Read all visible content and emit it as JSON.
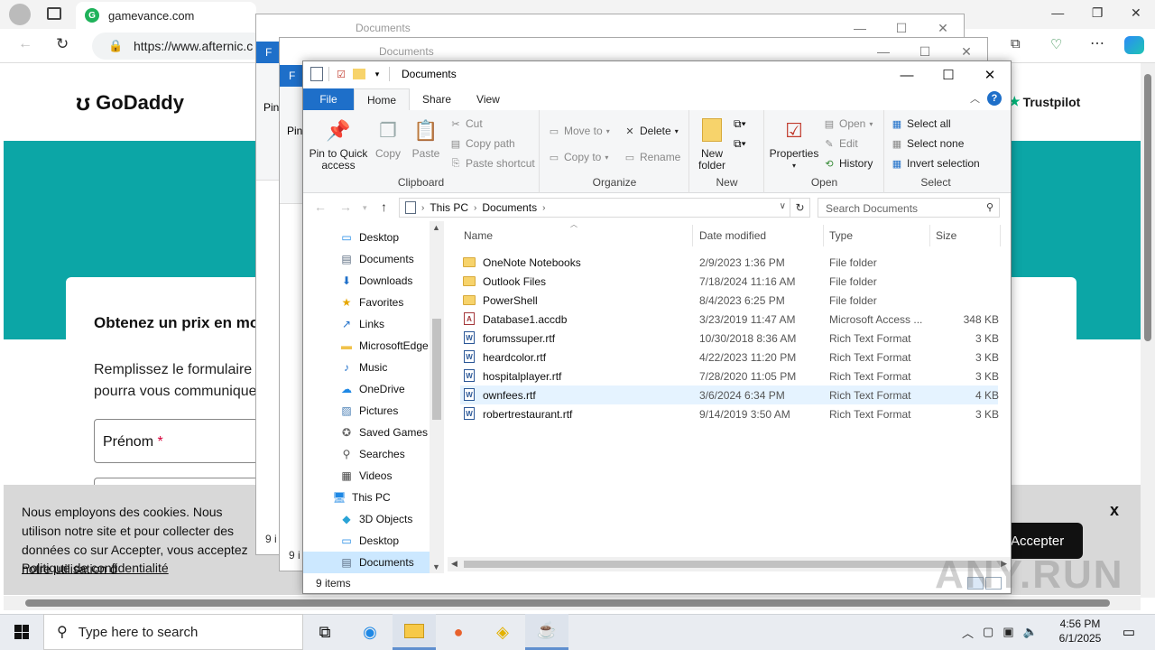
{
  "browser": {
    "tab_title": "gamevance.com",
    "url": "https://www.afternic.c",
    "window_controls": [
      "—",
      "❐",
      "✕"
    ]
  },
  "website": {
    "logo_text": "GoDaddy",
    "trustpilot": "Trustpilot",
    "form_title": "Obtenez un prix en mo",
    "form_desc": "Remplissez le formulaire c pourra vous communique",
    "field_firstname": "Prénom",
    "required_mark": "*",
    "cookie_text": "Nous employons des cookies. Nous utilison notre site et pour collecter des données co sur Accepter, vous acceptez notre utilisation d",
    "cookie_link": "Politique de confidentialité",
    "accept_button": "Accepter",
    "cookie_close": "x"
  },
  "bg_windows": [
    {
      "title": "Documents",
      "file_tab": "F",
      "pin": "Pin",
      "status": "9 i"
    },
    {
      "title": "Documents",
      "file_tab": "F",
      "pin": "Pin",
      "status": "9 i"
    }
  ],
  "explorer": {
    "title": "Documents",
    "tabs": {
      "file": "File",
      "home": "Home",
      "share": "Share",
      "view": "View"
    },
    "ribbon": {
      "clipboard": {
        "label": "Clipboard",
        "pin": "Pin to Quick access",
        "copy": "Copy",
        "paste": "Paste",
        "cut": "Cut",
        "copy_path": "Copy path",
        "paste_shortcut": "Paste shortcut"
      },
      "organize": {
        "label": "Organize",
        "move_to": "Move to",
        "copy_to": "Copy to",
        "delete": "Delete",
        "rename": "Rename"
      },
      "new": {
        "label": "New",
        "new_folder": "New folder"
      },
      "open": {
        "label": "Open",
        "properties": "Properties",
        "open": "Open",
        "edit": "Edit",
        "history": "History"
      },
      "select": {
        "label": "Select",
        "select_all": "Select all",
        "select_none": "Select none",
        "invert": "Invert selection"
      }
    },
    "breadcrumb": [
      "This PC",
      "Documents"
    ],
    "search_placeholder": "Search Documents",
    "nav_items": [
      {
        "label": "Desktop",
        "icon": "desktop-icon",
        "glyph": "▭",
        "color": "#1e88e5"
      },
      {
        "label": "Documents",
        "icon": "documents-icon",
        "glyph": "▤",
        "color": "#5a6b80"
      },
      {
        "label": "Downloads",
        "icon": "downloads-icon",
        "glyph": "⬇",
        "color": "#1e6fc9"
      },
      {
        "label": "Favorites",
        "icon": "star-icon",
        "glyph": "★",
        "color": "#e6a700"
      },
      {
        "label": "Links",
        "icon": "link-icon",
        "glyph": "↗",
        "color": "#1e6fc9"
      },
      {
        "label": "MicrosoftEdge",
        "icon": "folder-icon",
        "glyph": "▬",
        "color": "#f0c24b"
      },
      {
        "label": "Music",
        "icon": "music-icon",
        "glyph": "♪",
        "color": "#1e6fc9"
      },
      {
        "label": "OneDrive",
        "icon": "cloud-icon",
        "glyph": "☁",
        "color": "#1e88e5"
      },
      {
        "label": "Pictures",
        "icon": "pictures-icon",
        "glyph": "▨",
        "color": "#4a7fb5"
      },
      {
        "label": "Saved Games",
        "icon": "games-icon",
        "glyph": "✪",
        "color": "#666"
      },
      {
        "label": "Searches",
        "icon": "search-icon",
        "glyph": "⚲",
        "color": "#555"
      },
      {
        "label": "Videos",
        "icon": "video-icon",
        "glyph": "▦",
        "color": "#444"
      },
      {
        "label": "This PC",
        "icon": "computer-icon",
        "glyph": "🖥",
        "color": "#1e88e5"
      },
      {
        "label": "3D Objects",
        "icon": "cube-icon",
        "glyph": "◆",
        "color": "#29a3d6"
      },
      {
        "label": "Desktop",
        "icon": "desktop-icon",
        "glyph": "▭",
        "color": "#1e88e5"
      },
      {
        "label": "Documents",
        "icon": "documents-icon",
        "glyph": "▤",
        "color": "#5a6b80"
      }
    ],
    "columns": {
      "name": "Name",
      "date": "Date modified",
      "type": "Type",
      "size": "Size"
    },
    "files": [
      {
        "name": "OneNote Notebooks",
        "date": "2/9/2023 1:36 PM",
        "type": "File folder",
        "size": "",
        "kind": "folder"
      },
      {
        "name": "Outlook Files",
        "date": "7/18/2024 11:16 AM",
        "type": "File folder",
        "size": "",
        "kind": "folder"
      },
      {
        "name": "PowerShell",
        "date": "8/4/2023 6:25 PM",
        "type": "File folder",
        "size": "",
        "kind": "folder"
      },
      {
        "name": "Database1.accdb",
        "date": "3/23/2019 11:47 AM",
        "type": "Microsoft Access ...",
        "size": "348 KB",
        "kind": "access"
      },
      {
        "name": "forumssuper.rtf",
        "date": "10/30/2018 8:36 AM",
        "type": "Rich Text Format",
        "size": "3 KB",
        "kind": "doc"
      },
      {
        "name": "heardcolor.rtf",
        "date": "4/22/2023 11:20 PM",
        "type": "Rich Text Format",
        "size": "3 KB",
        "kind": "doc"
      },
      {
        "name": "hospitalplayer.rtf",
        "date": "7/28/2020 11:05 PM",
        "type": "Rich Text Format",
        "size": "3 KB",
        "kind": "doc"
      },
      {
        "name": "ownfees.rtf",
        "date": "3/6/2024 6:34 PM",
        "type": "Rich Text Format",
        "size": "4 KB",
        "kind": "doc",
        "selected": true
      },
      {
        "name": "robertrestaurant.rtf",
        "date": "9/14/2019 3:50 AM",
        "type": "Rich Text Format",
        "size": "3 KB",
        "kind": "doc"
      }
    ],
    "status": "9 items"
  },
  "watermark": "ANY.RUN",
  "taskbar": {
    "search_placeholder": "Type here to search",
    "time": "4:56 PM",
    "date": "6/1/2025"
  }
}
